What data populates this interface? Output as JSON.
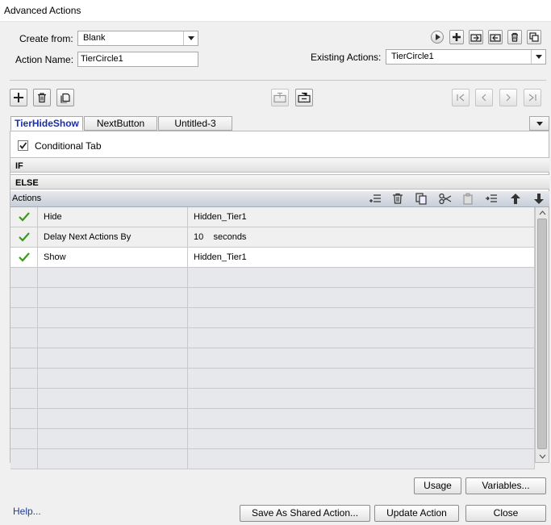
{
  "window": {
    "title": "Advanced Actions"
  },
  "create_from": {
    "label": "Create from:",
    "value": "Blank"
  },
  "action_name": {
    "label": "Action Name:",
    "value": "TierCircle1"
  },
  "existing_actions": {
    "label": "Existing Actions:",
    "value": "TierCircle1"
  },
  "tabs": [
    {
      "label": "TierHideShow",
      "active": true
    },
    {
      "label": "NextButton",
      "active": false
    },
    {
      "label": "Untitled-3",
      "active": false
    }
  ],
  "conditional_tab": {
    "label": "Conditional Tab",
    "checked": true
  },
  "if_label": "IF",
  "else_label": "ELSE",
  "actions_header": "Actions",
  "actions": [
    {
      "action": "Hide",
      "target": "Hidden_Tier1",
      "selected": false
    },
    {
      "action": "Delay Next Actions By",
      "target": "10    seconds",
      "selected": false
    },
    {
      "action": "Show",
      "target": "Hidden_Tier1",
      "selected": true
    }
  ],
  "buttons": {
    "usage": "Usage",
    "variables": "Variables...",
    "help": "Help...",
    "save_shared": "Save As Shared Action...",
    "update": "Update Action",
    "close": "Close"
  },
  "colors": {
    "accent": "#1a2fa8",
    "check": "#3a9a1a"
  }
}
